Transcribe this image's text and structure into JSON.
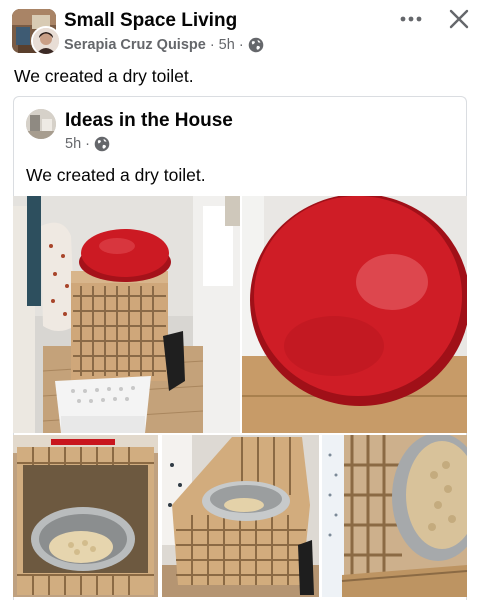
{
  "header": {
    "group_name": "Small Space Living",
    "author": "Serapia Cruz Quispe",
    "separator": "·",
    "time": "5h",
    "privacy_icon": "globe-icon",
    "more_icon": "more-horizontal-icon",
    "close_icon": "close-icon"
  },
  "post": {
    "text": "We created a dry toilet."
  },
  "shared": {
    "page_name": "Ideas in the House",
    "time": "5h",
    "separator": "·",
    "privacy_icon": "globe-icon",
    "text": "We created a dry toilet."
  },
  "photos": [
    {
      "name": "photo-toilet-room"
    },
    {
      "name": "photo-red-lid-closeup"
    },
    {
      "name": "photo-crate-bucket"
    },
    {
      "name": "photo-crate-side"
    },
    {
      "name": "photo-bucket-closeup"
    }
  ],
  "colors": {
    "text_primary": "#050505",
    "text_secondary": "#65676b",
    "lid_red": "#c8161e",
    "wood": "#c9a57a",
    "border": "#dadde1"
  }
}
